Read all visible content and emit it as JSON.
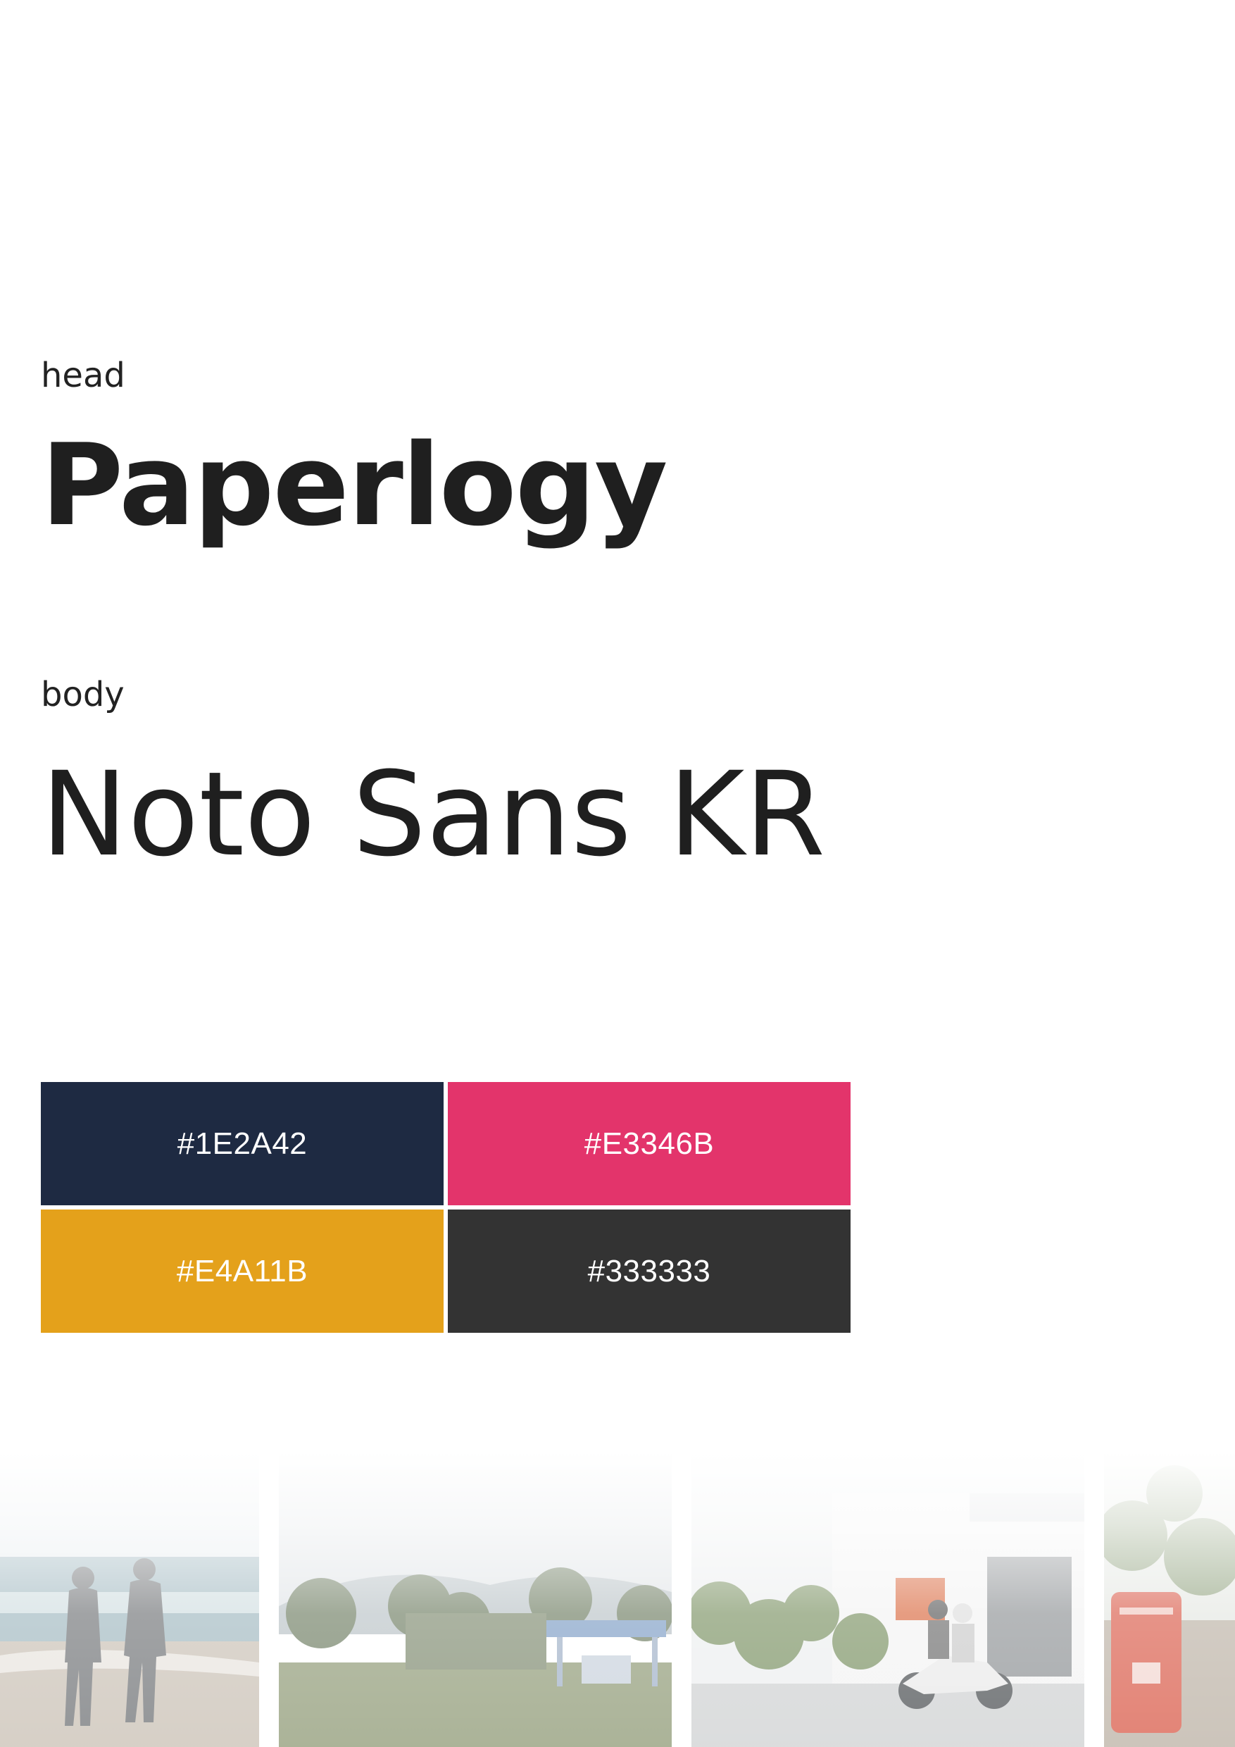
{
  "head": {
    "label": "head",
    "font_name": "Paperlogy"
  },
  "body": {
    "label": "body",
    "font_name": "Noto Sans KR"
  },
  "palette": [
    {
      "hex": "#1E2A42",
      "color": "#1E2A42"
    },
    {
      "hex": "#E3346B",
      "color": "#E3346B"
    },
    {
      "hex": "#E4A11B",
      "color": "#E4A11B"
    },
    {
      "hex": "#333333",
      "color": "#333333"
    }
  ],
  "photos": [
    {
      "icon": "beach-couple-photo"
    },
    {
      "icon": "park-pavilion-photo"
    },
    {
      "icon": "street-scooter-photo"
    },
    {
      "icon": "red-mailbox-photo"
    }
  ]
}
